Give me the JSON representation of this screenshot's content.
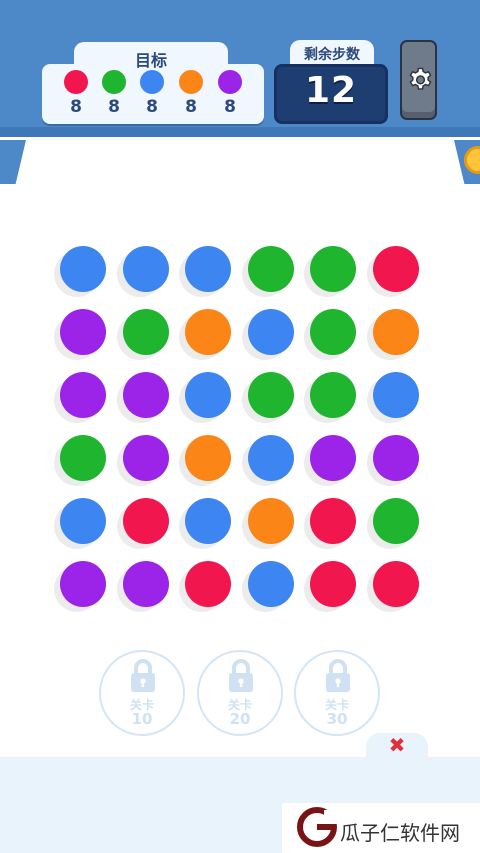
{
  "goals": {
    "title": "目标",
    "items": [
      {
        "color": "#f2164e",
        "count": "8"
      },
      {
        "color": "#1fb52e",
        "count": "8"
      },
      {
        "color": "#3d86f2",
        "count": "8"
      },
      {
        "color": "#fb8516",
        "count": "8"
      },
      {
        "color": "#9b24e8",
        "count": "8"
      }
    ]
  },
  "moves": {
    "label": "剩余步数",
    "value": "12"
  },
  "settings_icon": "gear-icon",
  "side_icons": {
    "left": "panel-tab",
    "right": "coin-icon"
  },
  "palette": {
    "red": "#f2164e",
    "green": "#1fb52e",
    "blue": "#3d86f2",
    "orange": "#fb8516",
    "purple": "#9b24e8"
  },
  "board": [
    [
      "blue",
      "blue",
      "blue",
      "green",
      "green",
      "red"
    ],
    [
      "purple",
      "green",
      "orange",
      "blue",
      "green",
      "orange"
    ],
    [
      "purple",
      "purple",
      "blue",
      "green",
      "green",
      "blue"
    ],
    [
      "green",
      "purple",
      "orange",
      "blue",
      "purple",
      "purple"
    ],
    [
      "blue",
      "red",
      "blue",
      "orange",
      "red",
      "green"
    ],
    [
      "purple",
      "purple",
      "red",
      "blue",
      "red",
      "red"
    ]
  ],
  "locks": [
    {
      "label": "关卡",
      "level": "10"
    },
    {
      "label": "关卡",
      "level": "20"
    },
    {
      "label": "关卡",
      "level": "30"
    }
  ],
  "close_icon": "close-icon",
  "watermark": {
    "text": "瓜子仁软件网"
  }
}
